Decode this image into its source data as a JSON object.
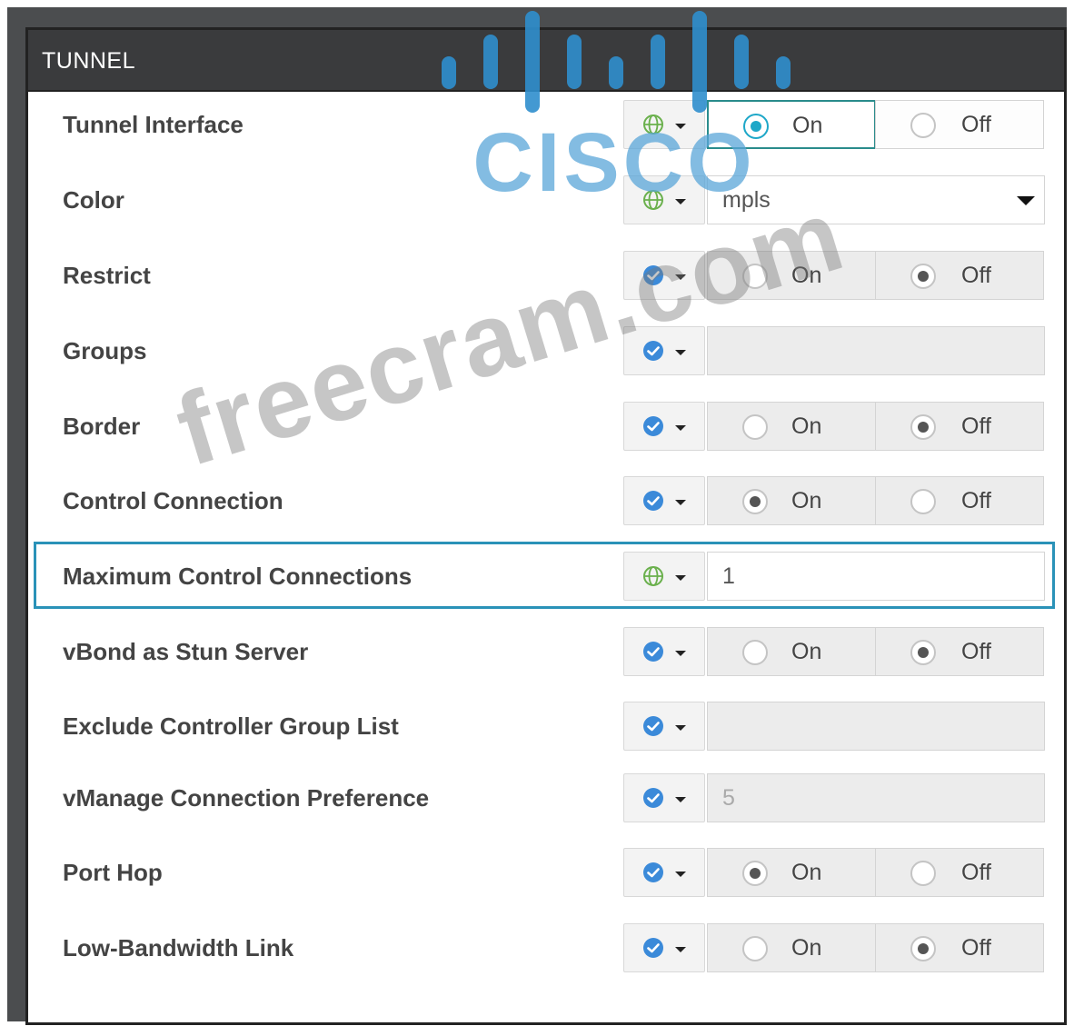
{
  "panel": {
    "title": "TUNNEL"
  },
  "rows": [
    {
      "label": "Tunnel Interface",
      "scope": "global",
      "type": "radio",
      "selected": "on",
      "on_label": "On",
      "off_label": "Off"
    },
    {
      "label": "Color",
      "scope": "global",
      "type": "select",
      "value": "mpls"
    },
    {
      "label": "Restrict",
      "scope": "default",
      "type": "radio",
      "selected": "off",
      "on_label": "On",
      "off_label": "Off"
    },
    {
      "label": "Groups",
      "scope": "default",
      "type": "input",
      "value": ""
    },
    {
      "label": "Border",
      "scope": "default",
      "type": "radio",
      "selected": "off",
      "on_label": "On",
      "off_label": "Off"
    },
    {
      "label": "Control Connection",
      "scope": "default",
      "type": "radio",
      "selected": "on",
      "on_label": "On",
      "off_label": "Off"
    },
    {
      "label": "Maximum Control Connections",
      "scope": "global",
      "type": "input",
      "value": "1",
      "highlighted": true
    },
    {
      "label": "vBond as Stun Server",
      "scope": "default",
      "type": "radio",
      "selected": "off",
      "on_label": "On",
      "off_label": "Off"
    },
    {
      "label": "Exclude Controller Group List",
      "scope": "default",
      "type": "input",
      "value": ""
    },
    {
      "label": "vManage Connection Preference",
      "scope": "default",
      "type": "input",
      "value": "5"
    },
    {
      "label": "Port Hop",
      "scope": "default",
      "type": "radio",
      "selected": "on",
      "on_label": "On",
      "off_label": "Off"
    },
    {
      "label": "Low-Bandwidth Link",
      "scope": "default",
      "type": "radio",
      "selected": "off",
      "on_label": "On",
      "off_label": "Off"
    }
  ],
  "logo": {
    "text": "CISCO"
  },
  "watermark": {
    "text": "freecram.com"
  },
  "colors": {
    "accent": "#2a92b8",
    "check": "#3b8ad9",
    "globe": "#6ab04c",
    "logo": "#2f8fce"
  }
}
